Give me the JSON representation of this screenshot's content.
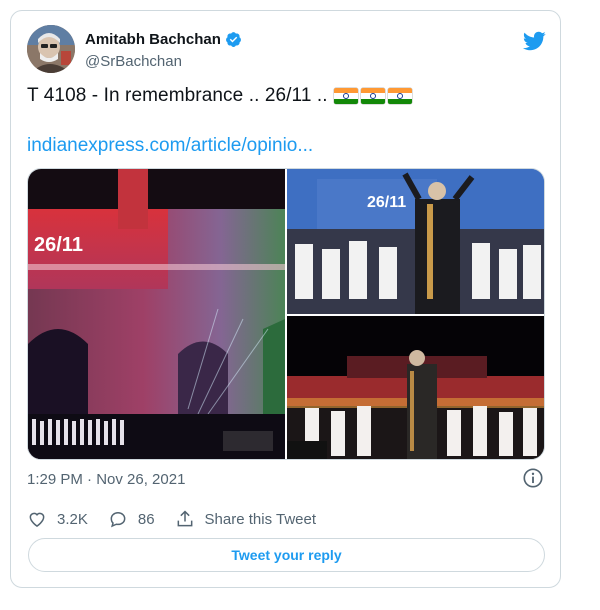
{
  "author": {
    "display_name": "Amitabh Bachchan",
    "handle": "@SrBachchan",
    "verified": true
  },
  "tweet": {
    "text": "T 4108 - In remembrance .. 26/11 ..",
    "flags": [
      "india-flag",
      "india-flag",
      "india-flag"
    ],
    "link": "indianexpress.com/article/opinio..."
  },
  "media": {
    "images": [
      {
        "name": "gateway-of-india-tricolor-photo",
        "overlay_text": "26/11"
      },
      {
        "name": "performers-stage-photo",
        "overlay_text": "26/11"
      },
      {
        "name": "night-tribute-stage-photo",
        "overlay_text": ""
      }
    ]
  },
  "meta": {
    "timestamp": "1:29 PM · Nov 26, 2021"
  },
  "actions": {
    "like_count": "3.2K",
    "reply_count": "86",
    "share_label": "Share this Tweet"
  },
  "reply": {
    "button_label": "Tweet your reply"
  },
  "colors": {
    "accent": "#1d9bf0",
    "text": "#0f1419",
    "muted": "#536471",
    "border": "#cfd9de"
  },
  "icons": [
    "verified-icon",
    "twitter-bird-icon",
    "info-icon",
    "heart-icon",
    "reply-icon",
    "share-icon"
  ]
}
